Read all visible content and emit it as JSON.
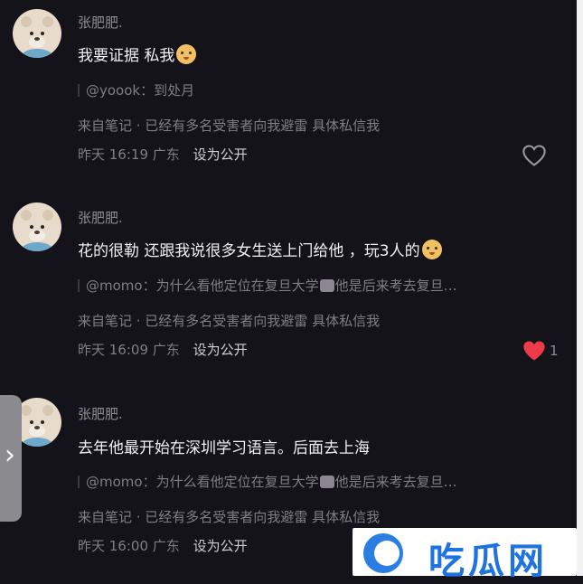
{
  "comments": [
    {
      "username": "张肥肥.",
      "content": "我要证据 私我",
      "quote": "@yoook：到处月",
      "source": "来自笔记 · 已经有多名受害者向我避雷 具体私信我",
      "time": "昨天 16:19",
      "location": "广东",
      "action": "设为公开",
      "liked": false,
      "like_count": ""
    },
    {
      "username": "张肥肥.",
      "content": "花的很勒 还跟我说很多女生送上门给他 ，玩3人的",
      "quote_prefix": "@momo：为什么看他定位在复旦大学",
      "quote_suffix": "他是后来考去复旦…",
      "source": "来自笔记 · 已经有多名受害者向我避雷 具体私信我",
      "time": "昨天 16:09",
      "location": "广东",
      "action": "设为公开",
      "liked": true,
      "like_count": "1"
    },
    {
      "username": "张肥肥.",
      "content": "去年他最开始在深圳学习语言。后面去上海",
      "quote_prefix": "@momo：为什么看他定位在复旦大学",
      "quote_suffix": "他是后来考去复旦…",
      "source": "来自笔记 · 已经有多名受害者向我避雷 具体私信我",
      "time": "昨天 16:00",
      "location": "广东",
      "action": "设为公开"
    }
  ],
  "watermark": {
    "text": "吃瓜网"
  },
  "colors": {
    "background": "#141319",
    "heart_liked": "#ee3b4a",
    "heart_outline": "#9a98a0",
    "watermark_blue": "#1f73e0"
  },
  "icons": {
    "like_unliked": "heart-outline-icon",
    "like_liked": "heart-filled-icon",
    "side_handle": "chevron-right-icon"
  }
}
